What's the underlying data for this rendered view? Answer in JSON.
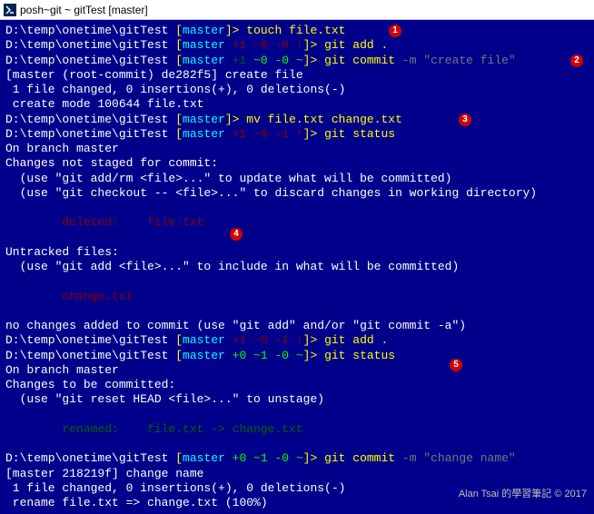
{
  "title": "posh~git ~ gitTest [master]",
  "lines": {
    "l1p": "D:\\temp\\onetime\\gitTest ",
    "l1b": "[",
    "l1m": "master",
    "l1e": "]> ",
    "l1c": "touch file.txt",
    "l2p": "D:\\temp\\onetime\\gitTest ",
    "l2b": "[",
    "l2m": "master ",
    "l2s1": "+1 ",
    "l2s2": "~0 -0 !",
    "l2e": "]> ",
    "l2c": "git add .",
    "l3p": "D:\\temp\\onetime\\gitTest ",
    "l3b": "[",
    "l3m": "master ",
    "l3s1": "+1 ",
    "l3s2": "~0 -0 ~",
    "l3e": "]> ",
    "l3c1": "git commit ",
    "l3c2": "-m ",
    "l3c3": "\"create file\"",
    "l4": "[master (root-commit) de282f5] create file",
    "l5": " 1 file changed, 0 insertions(+), 0 deletions(-)",
    "l6": " create mode 100644 file.txt",
    "l7p": "D:\\temp\\onetime\\gitTest ",
    "l7b": "[",
    "l7m": "master",
    "l7e": "]> ",
    "l7c": "mv file.txt change.txt",
    "l8p": "D:\\temp\\onetime\\gitTest ",
    "l8b": "[",
    "l8m": "master ",
    "l8s1": "+1 ",
    "l8s2": "~0 -1 !",
    "l8e": "]> ",
    "l8c": "git status",
    "l9": "On branch master",
    "l10": "Changes not staged for commit:",
    "l11": "  (use \"git add/rm <file>...\" to update what will be committed)",
    "l12": "  (use \"git checkout -- <file>...\" to discard changes in working directory)",
    "l13": "        deleted:    file.txt",
    "l14": "Untracked files:",
    "l15": "  (use \"git add <file>...\" to include in what will be committed)",
    "l16": "        change.txt",
    "l17": "no changes added to commit (use \"git add\" and/or \"git commit -a\")",
    "l18p": "D:\\temp\\onetime\\gitTest ",
    "l18b": "[",
    "l18m": "master ",
    "l18s1": "+1 ",
    "l18s2": "~0 -1 !",
    "l18e": "]> ",
    "l18c": "git add .",
    "l19p": "D:\\temp\\onetime\\gitTest ",
    "l19b": "[",
    "l19m": "master ",
    "l19s": "+0 ~1 -0 ~",
    "l19e": "]> ",
    "l19c": "git status",
    "l20": "On branch master",
    "l21": "Changes to be committed:",
    "l22": "  (use \"git reset HEAD <file>...\" to unstage)",
    "l23": "        renamed:    file.txt -> change.txt",
    "l24p": "D:\\temp\\onetime\\gitTest ",
    "l24b": "[",
    "l24m": "master ",
    "l24s": "+0 ~1 -0 ~",
    "l24e": "]> ",
    "l24c1": "git commit ",
    "l24c2": "-m ",
    "l24c3": "\"change name\"",
    "l25": "[master 218219f] change name",
    "l26": " 1 file changed, 0 insertions(+), 0 deletions(-)",
    "l27": " rename file.txt => change.txt (100%)"
  },
  "annot": {
    "a1": "1",
    "a2": "2",
    "a3": "3",
    "a4": "4",
    "a5": "5"
  },
  "watermark": "Alan Tsai 的學習筆記 © 2017"
}
